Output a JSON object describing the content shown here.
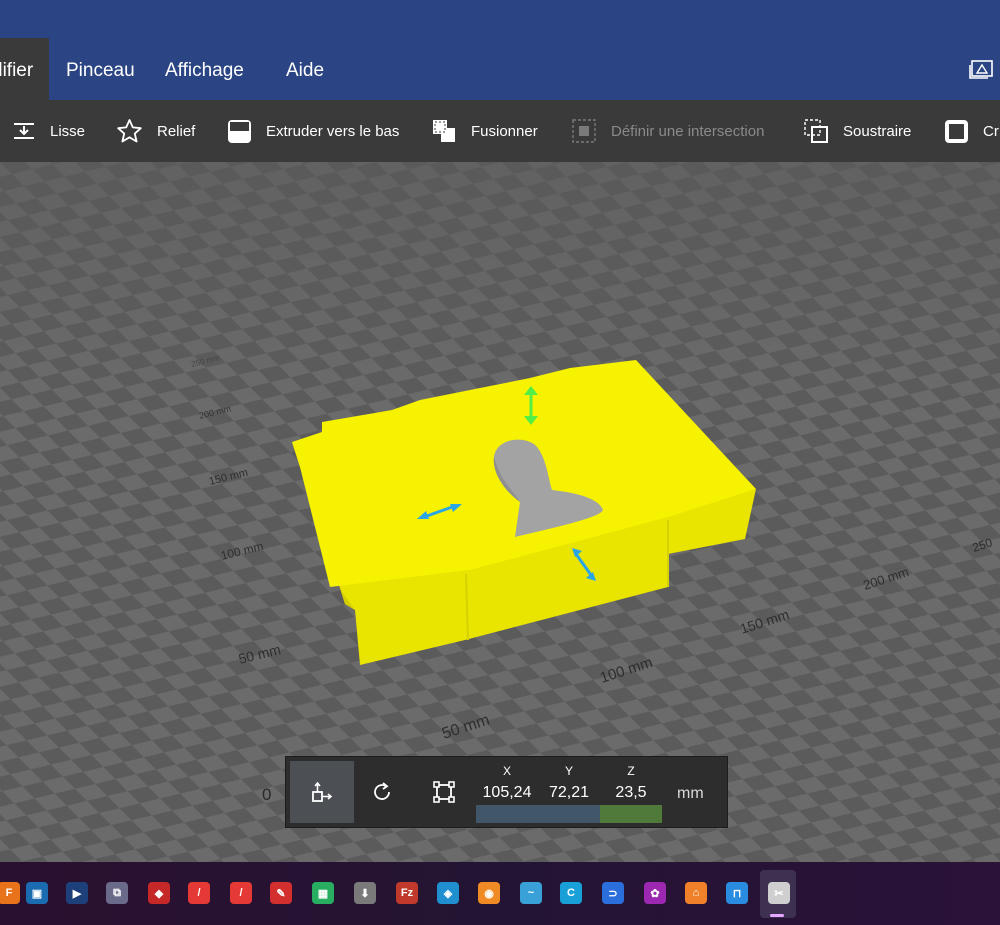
{
  "menu": {
    "items": [
      {
        "label": "difier",
        "active": true
      },
      {
        "label": "Pinceau",
        "active": false
      },
      {
        "label": "Affichage",
        "active": false
      },
      {
        "label": "Aide",
        "active": false
      }
    ]
  },
  "toolbar": {
    "items": [
      {
        "label": "Lisse",
        "icon": "smooth-icon",
        "enabled": true
      },
      {
        "label": "Relief",
        "icon": "star-icon",
        "enabled": true
      },
      {
        "label": "Extruder vers le bas",
        "icon": "extrude-down-icon",
        "enabled": true
      },
      {
        "label": "Fusionner",
        "icon": "merge-icon",
        "enabled": true
      },
      {
        "label": "Définir une intersection",
        "icon": "intersect-icon",
        "enabled": false
      },
      {
        "label": "Soustraire",
        "icon": "subtract-icon",
        "enabled": true
      },
      {
        "label": "Cr",
        "icon": "create-icon",
        "enabled": true
      }
    ]
  },
  "viewport": {
    "origin_label": "0",
    "axis_left_labels": [
      "50 mm",
      "100 mm",
      "150 mm",
      "200 mm",
      "250 mm"
    ],
    "axis_bottom_labels": [
      "50 mm",
      "100 mm",
      "150 mm",
      "200 mm",
      "250"
    ],
    "object_color": "#f5f000",
    "cutout_color": "#a3a3a3",
    "arrow_vertical_color": "#55ee44",
    "arrow_horizontal_color": "#2aa6e6"
  },
  "transform": {
    "modes": [
      "move-icon",
      "rotate-icon",
      "scale-icon"
    ],
    "x": {
      "label": "X",
      "value": "105,24",
      "color": "#42566a"
    },
    "y": {
      "label": "Y",
      "value": "72,21",
      "color": "#42566a"
    },
    "z": {
      "label": "Z",
      "value": "23,5",
      "color": "#4f7a3a"
    },
    "unit": "mm"
  },
  "taskbar": {
    "icons": [
      "fusion-icon",
      "sketchup-icon",
      "video-editor-icon",
      "network-icon",
      "app-red-icon",
      "pen-red-icon",
      "pen-red-2-icon",
      "acrobat-icon",
      "green-grid-icon",
      "installer-icon",
      "filezilla-icon",
      "kodi-icon",
      "app-orange-icon",
      "dolphin-icon",
      "c-app-icon",
      "switch-icon",
      "palm-icon",
      "orange-app-icon",
      "3d-builder-icon",
      "snip-icon"
    ]
  }
}
